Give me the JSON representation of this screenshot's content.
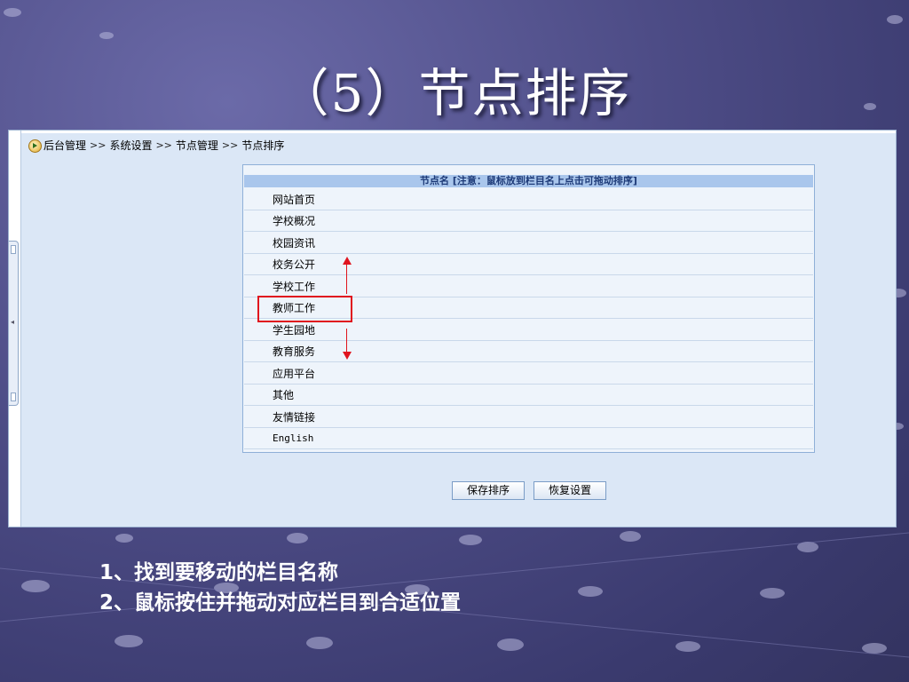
{
  "slide": {
    "title": "（5）节点排序"
  },
  "breadcrumb": {
    "items": [
      "后台管理",
      "系统设置",
      "节点管理",
      "节点排序"
    ],
    "separator": ">>"
  },
  "node_table": {
    "header": "节点名 [注意：鼠标放到栏目名上点击可拖动排序]",
    "rows": [
      "网站首页",
      "学校概况",
      "校园资讯",
      "校务公开",
      "学校工作",
      "教师工作",
      "学生园地",
      "教育服务",
      "应用平台",
      "其他",
      "友情链接",
      "English"
    ],
    "highlighted_row": "教师工作"
  },
  "buttons": {
    "save": "保存排序",
    "reset": "恢复设置"
  },
  "instructions": [
    "1、找到要移动的栏目名称",
    "2、鼠标按住并拖动对应栏目到合适位置"
  ],
  "colors": {
    "slide_background": "#4d4c86",
    "panel_background": "#dbe7f6",
    "table_header": "#a9c6ec",
    "highlight": "#e0141e"
  },
  "icons": {
    "breadcrumb_home": "home-icon",
    "drag_direction": "red-up-down-arrows"
  }
}
